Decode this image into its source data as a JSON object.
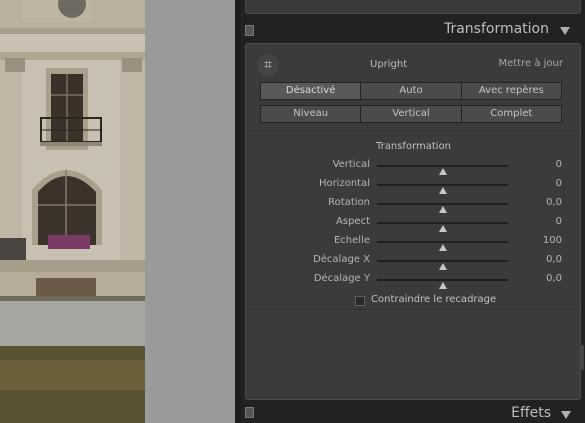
{
  "panel": {
    "title": "Transformation",
    "upright_label": "Upright",
    "update_link": "Mettre à jour",
    "row1": [
      {
        "label": "Désactivé",
        "selected": true
      },
      {
        "label": "Auto",
        "selected": false
      },
      {
        "label": "Avec repères",
        "selected": false
      }
    ],
    "row2": [
      {
        "label": "Niveau",
        "selected": false
      },
      {
        "label": "Vertical",
        "selected": false
      },
      {
        "label": "Complet",
        "selected": false
      }
    ],
    "subtitle": "Transformation",
    "sliders": [
      {
        "label": "Vertical",
        "value": "0",
        "level": 0.5
      },
      {
        "label": "Horizontal",
        "value": "0",
        "level": 0.5
      },
      {
        "label": "Rotation",
        "value": "0,0",
        "level": 0.5
      },
      {
        "label": "Aspect",
        "value": "0",
        "level": 0.5
      },
      {
        "label": "Echelle",
        "value": "100",
        "level": 0.5
      },
      {
        "label": "Décalage X",
        "value": "0,0",
        "level": 0.5
      },
      {
        "label": "Décalage Y",
        "value": "0,0",
        "level": 0.5
      }
    ],
    "constrain_label": "Contraindre le recadrage",
    "constrain_checked": false
  },
  "next_panel": {
    "title": "Effets"
  },
  "icons": {
    "crop": "crop-icon",
    "collapse": "triangle-down-icon",
    "panel_toggle": "panel-switch-icon"
  }
}
